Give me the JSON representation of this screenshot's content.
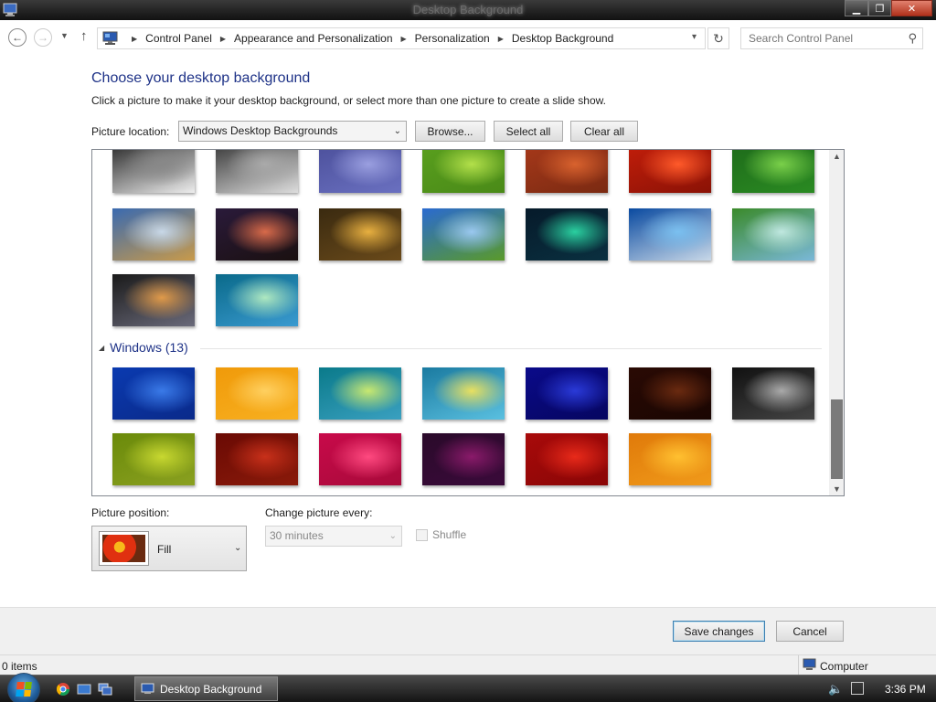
{
  "window": {
    "title": "Desktop Background"
  },
  "nav": {
    "breadcrumbs": [
      "Control Panel",
      "Appearance and Personalization",
      "Personalization",
      "Desktop Background"
    ],
    "search_placeholder": "Search Control Panel"
  },
  "main": {
    "heading": "Choose your desktop background",
    "subtext": "Click a picture to make it your desktop background, or select more than one picture to create a slide show.",
    "location_label": "Picture location:",
    "location_value": "Windows Desktop Backgrounds",
    "browse_label": "Browse...",
    "select_all_label": "Select all",
    "clear_all_label": "Clear all"
  },
  "gallery": {
    "top_thumbs": [
      {
        "name": "black-white-trees",
        "colors": [
          "#222",
          "#888",
          "#eee"
        ]
      },
      {
        "name": "black-white-rocks",
        "colors": [
          "#333",
          "#aaa",
          "#ddd"
        ]
      },
      {
        "name": "pebbles",
        "colors": [
          "#4b4f9a",
          "#9a9fe0",
          "#6a70c0"
        ]
      },
      {
        "name": "green-leaf",
        "colors": [
          "#5aa01e",
          "#b3e04a",
          "#4a8a18"
        ]
      },
      {
        "name": "wood-knot",
        "colors": [
          "#a8391a",
          "#d8622e",
          "#7a2a12"
        ]
      },
      {
        "name": "red-flower",
        "colors": [
          "#c41e0a",
          "#ff5a2a",
          "#8a1206"
        ]
      },
      {
        "name": "bamboo",
        "colors": [
          "#1e6a1a",
          "#7ad04a",
          "#2a8a22"
        ]
      },
      {
        "name": "mountain-lake",
        "colors": [
          "#3a6ab0",
          "#c8d8e8",
          "#c89a4a"
        ]
      },
      {
        "name": "sunset-city",
        "colors": [
          "#2a1a3a",
          "#d86a4a",
          "#1a1010"
        ]
      },
      {
        "name": "golden-beach",
        "colors": [
          "#3a2a10",
          "#e8b040",
          "#6a4a1a"
        ]
      },
      {
        "name": "green-hills",
        "colors": [
          "#2a6ad0",
          "#9ac8f0",
          "#5a9a2a"
        ]
      },
      {
        "name": "aurora",
        "colors": [
          "#061a2a",
          "#2ad0a0",
          "#0a3040"
        ]
      },
      {
        "name": "fish-school",
        "colors": [
          "#0a4aa0",
          "#7ac0f0",
          "#c8d8e8"
        ]
      },
      {
        "name": "palm-frond",
        "colors": [
          "#3a8a2a",
          "#c0e8e0",
          "#7ab8d8"
        ]
      },
      {
        "name": "rock-reflection",
        "colors": [
          "#1a1a1a",
          "#e09a4a",
          "#6a6a7a"
        ]
      },
      {
        "name": "vista-aurora",
        "colors": [
          "#0a6a8a",
          "#aee8c0",
          "#3a9ad0"
        ]
      }
    ],
    "group_name": "Windows (13)",
    "windows_thumbs": [
      {
        "name": "blue-swirl",
        "colors": [
          "#0a3ab0",
          "#3a7ae8",
          "#0a2a8a"
        ]
      },
      {
        "name": "orange-origami",
        "colors": [
          "#f09a0a",
          "#ffd060",
          "#f8b020"
        ]
      },
      {
        "name": "vista-green",
        "colors": [
          "#0a7a8a",
          "#c8e870",
          "#3aa0c0"
        ]
      },
      {
        "name": "windows7-logo",
        "colors": [
          "#1a7aa0",
          "#e8e060",
          "#5ac0e0"
        ]
      },
      {
        "name": "deep-blue",
        "colors": [
          "#0a0a8a",
          "#2a3ad8",
          "#060660"
        ]
      },
      {
        "name": "brown-swirl",
        "colors": [
          "#2a0a04",
          "#6a2a10",
          "#1a0602"
        ]
      },
      {
        "name": "black-white-swirl",
        "colors": [
          "#111",
          "#aaa",
          "#444"
        ]
      },
      {
        "name": "olive-swirl",
        "colors": [
          "#6a8a0a",
          "#c8d830",
          "#8aa020"
        ]
      },
      {
        "name": "dark-red-swirl",
        "colors": [
          "#6a0a04",
          "#c8301a",
          "#8a1a0a"
        ]
      },
      {
        "name": "pink-swirl",
        "colors": [
          "#c80a4a",
          "#ff4a80",
          "#a80a3a"
        ]
      },
      {
        "name": "purple-swirl",
        "colors": [
          "#2a0a2a",
          "#8a1a6a",
          "#3a0a3a"
        ]
      },
      {
        "name": "red-swirl",
        "colors": [
          "#a80a0a",
          "#e82a1a",
          "#8a0606"
        ]
      },
      {
        "name": "amber-swirl",
        "colors": [
          "#e07a0a",
          "#ffc030",
          "#f09a1a"
        ]
      }
    ]
  },
  "options": {
    "position_label": "Picture position:",
    "position_value": "Fill",
    "change_label": "Change picture every:",
    "change_value": "30 minutes",
    "shuffle_label": "Shuffle"
  },
  "footer": {
    "save_label": "Save changes",
    "cancel_label": "Cancel"
  },
  "status": {
    "items": "0 items",
    "location": "Computer"
  },
  "taskbar": {
    "task_label": "Desktop Background",
    "clock": "3:36 PM"
  },
  "colors": {
    "accent": "#1e3287",
    "titlebar": "#1a1a1a",
    "close": "#c8402a"
  }
}
